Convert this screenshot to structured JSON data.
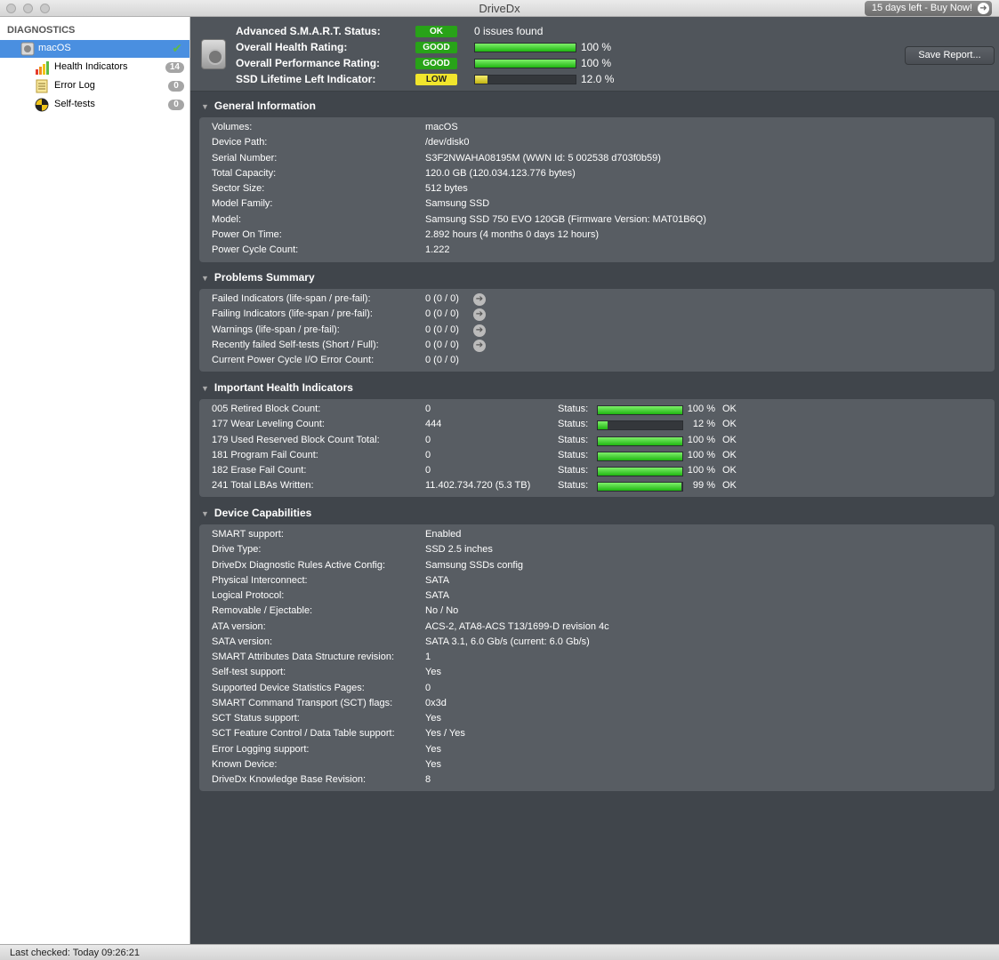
{
  "window": {
    "title": "DriveDx",
    "trial_label": "15 days left - Buy Now!"
  },
  "sidebar": {
    "section": "DIAGNOSTICS",
    "items": [
      {
        "label": "macOS",
        "badge": ""
      },
      {
        "label": "Health Indicators",
        "badge": "14"
      },
      {
        "label": "Error Log",
        "badge": "0"
      },
      {
        "label": "Self-tests",
        "badge": "0"
      }
    ]
  },
  "header": {
    "smart_label": "Advanced S.M.A.R.T. Status:",
    "smart_badge": "OK",
    "smart_value": "0 issues found",
    "health_label": "Overall Health Rating:",
    "health_badge": "GOOD",
    "health_pct": "100 %",
    "health_fill": 1.0,
    "perf_label": "Overall Performance Rating:",
    "perf_badge": "GOOD",
    "perf_pct": "100 %",
    "perf_fill": 1.0,
    "ssd_label": "SSD Lifetime Left Indicator:",
    "ssd_badge": "LOW",
    "ssd_pct": "12.0 %",
    "ssd_fill": 0.12,
    "save_label": "Save Report..."
  },
  "general": {
    "title": "General Information",
    "rows": [
      {
        "k": "Volumes:",
        "v": "macOS"
      },
      {
        "k": "Device Path:",
        "v": "/dev/disk0"
      },
      {
        "k": "Serial Number:",
        "v": "S3F2NWAHA08195M (WWN Id: 5 002538 d703f0b59)"
      },
      {
        "k": "Total Capacity:",
        "v": "120.0 GB (120.034.123.776 bytes)"
      },
      {
        "k": "Sector Size:",
        "v": "512 bytes"
      },
      {
        "k": "Model Family:",
        "v": "Samsung SSD"
      },
      {
        "k": "Model:",
        "v": "Samsung SSD 750 EVO 120GB  (Firmware Version: MAT01B6Q)"
      },
      {
        "k": "Power On Time:",
        "v": "2.892 hours (4 months 0 days 12 hours)"
      },
      {
        "k": "Power Cycle Count:",
        "v": "1.222"
      }
    ]
  },
  "problems": {
    "title": "Problems Summary",
    "rows": [
      {
        "k": "Failed Indicators (life-span / pre-fail):",
        "v": "0 (0 / 0)",
        "arrow": true
      },
      {
        "k": "Failing Indicators (life-span / pre-fail):",
        "v": "0 (0 / 0)",
        "arrow": true
      },
      {
        "k": "Warnings (life-span / pre-fail):",
        "v": "0 (0 / 0)",
        "arrow": true
      },
      {
        "k": "Recently failed Self-tests (Short / Full):",
        "v": "0 (0 / 0)",
        "arrow": true
      },
      {
        "k": "Current Power Cycle I/O Error Count:",
        "v": "0 (0 / 0)",
        "arrow": false
      }
    ]
  },
  "indicators": {
    "title": "Important Health Indicators",
    "status_label": "Status:",
    "rows": [
      {
        "k": "005  Retired Block Count:",
        "v": "0",
        "pct": "100 %",
        "fill": 1.0,
        "ok": "OK"
      },
      {
        "k": "177  Wear Leveling Count:",
        "v": "444",
        "pct": "12 %",
        "fill": 0.12,
        "ok": "OK"
      },
      {
        "k": "179  Used Reserved Block Count Total:",
        "v": "0",
        "pct": "100 %",
        "fill": 1.0,
        "ok": "OK"
      },
      {
        "k": "181  Program Fail Count:",
        "v": "0",
        "pct": "100 %",
        "fill": 1.0,
        "ok": "OK"
      },
      {
        "k": "182  Erase Fail Count:",
        "v": "0",
        "pct": "100 %",
        "fill": 1.0,
        "ok": "OK"
      },
      {
        "k": "241  Total LBAs Written:",
        "v": "11.402.734.720 (5.3 TB)",
        "pct": "99 %",
        "fill": 0.99,
        "ok": "OK"
      }
    ]
  },
  "capabilities": {
    "title": "Device Capabilities",
    "rows": [
      {
        "k": "SMART support:",
        "v": "Enabled"
      },
      {
        "k": "Drive Type:",
        "v": "SSD 2.5 inches"
      },
      {
        "k": "DriveDx Diagnostic Rules Active Config:",
        "v": "Samsung SSDs config"
      },
      {
        "k": "Physical Interconnect:",
        "v": "SATA"
      },
      {
        "k": "Logical Protocol:",
        "v": "SATA"
      },
      {
        "k": "Removable / Ejectable:",
        "v": "No / No"
      },
      {
        "k": "ATA version:",
        "v": "ACS-2, ATA8-ACS T13/1699-D revision 4c"
      },
      {
        "k": "SATA version:",
        "v": "SATA 3.1, 6.0 Gb/s (current: 6.0 Gb/s)"
      },
      {
        "k": "SMART Attributes Data Structure revision:",
        "v": "1"
      },
      {
        "k": "Self-test support:",
        "v": "Yes"
      },
      {
        "k": "Supported Device Statistics Pages:",
        "v": "0"
      },
      {
        "k": "SMART Command Transport (SCT) flags:",
        "v": "0x3d"
      },
      {
        "k": "SCT Status support:",
        "v": "Yes"
      },
      {
        "k": "SCT Feature Control / Data Table support:",
        "v": "Yes / Yes"
      },
      {
        "k": "Error Logging support:",
        "v": "Yes"
      },
      {
        "k": "Known Device:",
        "v": "Yes"
      },
      {
        "k": "DriveDx Knowledge Base Revision:",
        "v": "8"
      }
    ]
  },
  "status": {
    "last_checked": "Last checked: Today 09:26:21"
  }
}
